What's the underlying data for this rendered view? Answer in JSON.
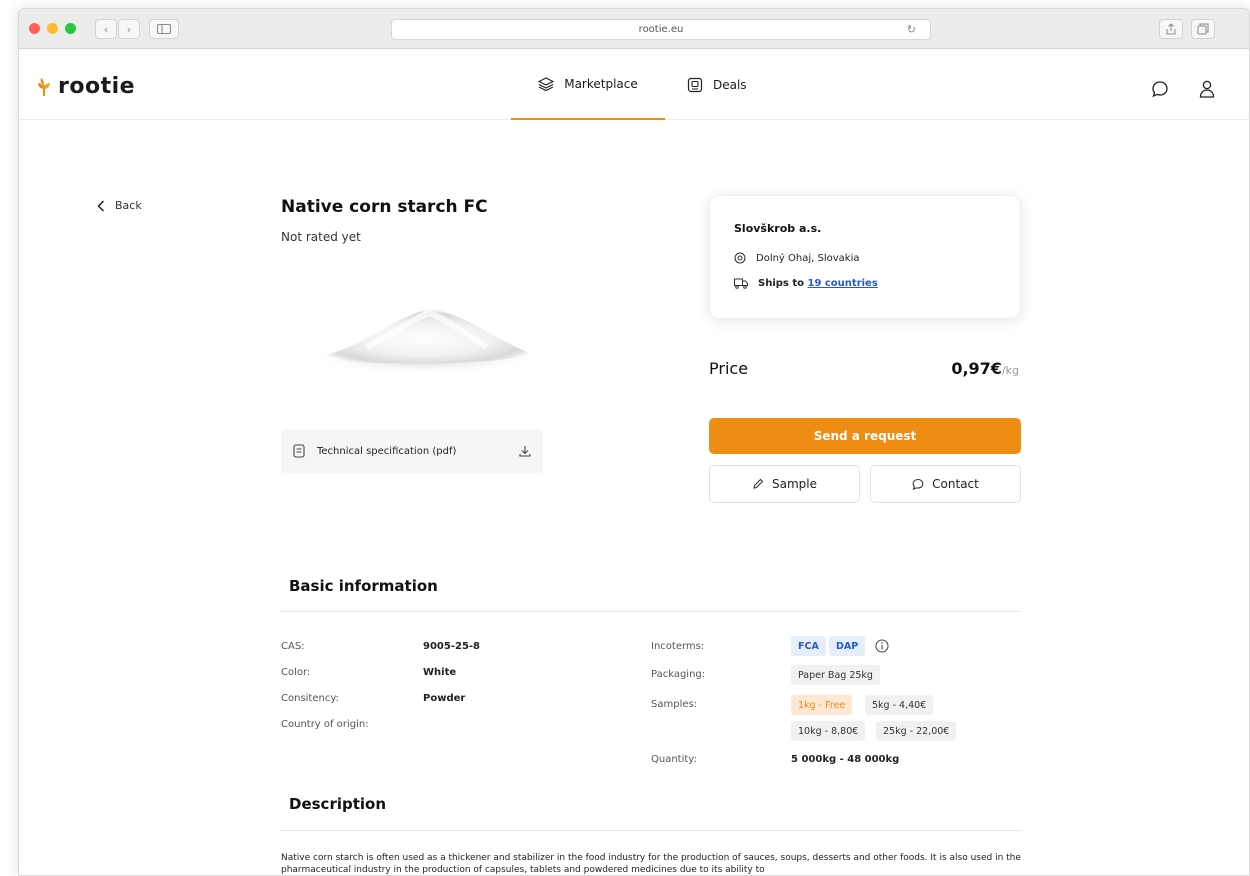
{
  "browser": {
    "url": "rootie.eu",
    "back_glyph": "‹",
    "forward_glyph": "›"
  },
  "header": {
    "logo_text": "rootie",
    "nav": [
      {
        "label": "Marketplace",
        "icon": "layers-icon",
        "active": true
      },
      {
        "label": "Deals",
        "icon": "deals-icon",
        "active": false
      }
    ],
    "accent_color": "#ef8c14"
  },
  "product": {
    "back_label": "Back",
    "title": "Native corn starch FC",
    "rating_text": "Not rated yet",
    "spec_label": "Technical specification (pdf)"
  },
  "seller": {
    "name": "Slovškrob a.s.",
    "location": "Dolný Ohaj, Slovakia",
    "ships_prefix": "Ships to",
    "ships_link": "19 countries"
  },
  "pricing": {
    "label": "Price",
    "value": "0,97€",
    "unit": "/kg"
  },
  "actions": {
    "request_label": "Send a request",
    "sample_label": "Sample",
    "contact_label": "Contact"
  },
  "basic_info": {
    "title": "Basic information",
    "left": [
      {
        "label": "CAS:",
        "value": "9005-25-8"
      },
      {
        "label": "Color:",
        "value": "White"
      },
      {
        "label": "Consitency:",
        "value": "Powder"
      },
      {
        "label": "Country of origin:",
        "value": ""
      }
    ],
    "incoterms_label": "Incoterms:",
    "incoterms": [
      "FCA",
      "DAP"
    ],
    "packaging_label": "Packaging:",
    "packaging": "Paper Bag 25kg",
    "samples_label": "Samples:",
    "samples": [
      "1kg - Free",
      "5kg - 4,40€",
      "10kg - 8,80€",
      "25kg - 22,00€"
    ],
    "quantity_label": "Quantity:",
    "quantity": "5 000kg - 48 000kg"
  },
  "description": {
    "title": "Description",
    "text": "Native corn starch is often used as a thickener and stabilizer in the food industry for the production of sauces, soups, desserts and other foods. It is also used in the pharmaceutical industry in the production of capsules, tablets and powdered medicines due to its ability to"
  }
}
